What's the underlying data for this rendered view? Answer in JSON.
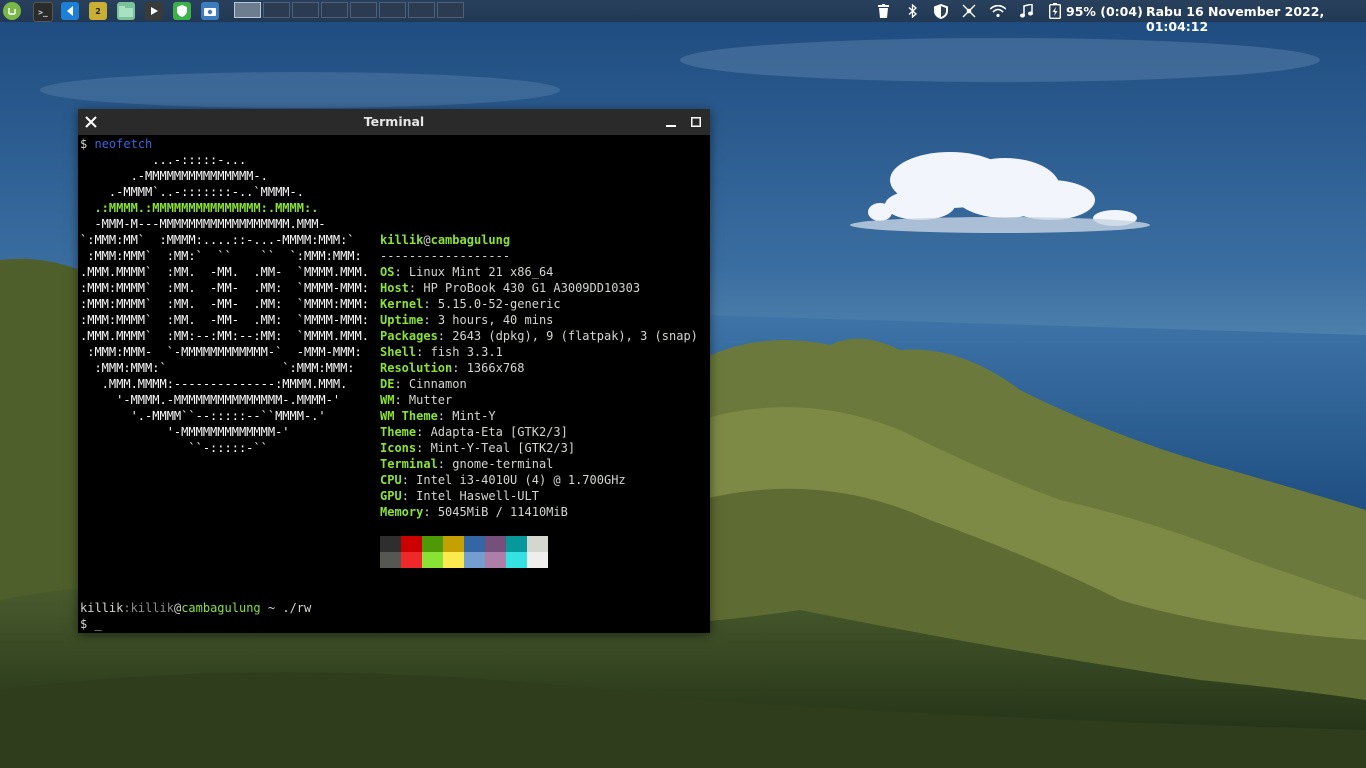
{
  "panel": {
    "launchers": [
      {
        "icon": "mint-menu-icon",
        "color": "#7ab648"
      },
      {
        "icon": "terminal-launcher-icon",
        "color": "#2b2b2b"
      },
      {
        "icon": "vscode-icon",
        "color": "#1f7fd4"
      },
      {
        "icon": "app-icon",
        "color": "#c9b034"
      },
      {
        "icon": "files-icon",
        "color": "#7bc29a"
      },
      {
        "icon": "media-player-icon",
        "color": "#3a3a3a"
      },
      {
        "icon": "shield-app-icon",
        "color": "#3cb04a"
      },
      {
        "icon": "screenshot-icon",
        "color": "#3d7bbf"
      }
    ],
    "workspaces": 8,
    "active_workspace": 1,
    "battery": "95% (0:04)",
    "clock": "Rabu 16 November 2022, 01:04:12"
  },
  "terminal": {
    "title": "Terminal",
    "prompt_symbol": "$",
    "command": "neofetch",
    "logo": [
      "          ...-:::::-...",
      "       .-MMMMMMMMMMMMMMM-.",
      "    .-MMMM`..-:::::::-..`MMMM-.",
      "  .:MMMM.:MMMMMMMMMMMMMMM:.MMMM:.",
      "  -MMM-M---MMMMMMMMMMMMMMMMMM.MMM-",
      "`:MMM:MM`  :MMMM:....::-...-MMMM:MMM:`",
      " :MMM:MMM`  :MM:`  ``    ``  `:MMM:MMM:",
      ".MMM.MMMM`  :MM.  -MM.  .MM-  `MMMM.MMM.",
      ":MMM:MMMM`  :MM.  -MM-  .MM:  `MMMM-MMM:",
      ":MMM:MMMM`  :MM.  -MM-  .MM:  `MMMM:MMM:",
      ":MMM:MMMM`  :MM.  -MM-  .MM:  `MMMM-MMM:",
      ".MMM.MMMM`  :MM:--:MM:--:MM:  `MMMM.MMM.",
      " :MMM:MMM-  `-MMMMMMMMMMMM-`  -MMM-MMM:",
      "  :MMM:MMM:`                `:MMM:MMM:",
      "   .MMM.MMMM:--------------:MMMM.MMM.",
      "     '-MMMM.-MMMMMMMMMMMMMMM-.MMMM-'",
      "       '.-MMMM``--:::::--``MMMM-.'",
      "            '-MMMMMMMMMMMMM-'",
      "               ``-:::::-``"
    ],
    "info": {
      "user": "killik",
      "host": "cambagulung",
      "separator": "------------------",
      "fields": [
        {
          "key": "OS",
          "value": "Linux Mint 21 x86_64"
        },
        {
          "key": "Host",
          "value": "HP ProBook 430 G1 A3009DD10303"
        },
        {
          "key": "Kernel",
          "value": "5.15.0-52-generic"
        },
        {
          "key": "Uptime",
          "value": "3 hours, 40 mins"
        },
        {
          "key": "Packages",
          "value": "2643 (dpkg), 9 (flatpak), 3 (snap)"
        },
        {
          "key": "Shell",
          "value": "fish 3.3.1"
        },
        {
          "key": "Resolution",
          "value": "1366x768"
        },
        {
          "key": "DE",
          "value": "Cinnamon"
        },
        {
          "key": "WM",
          "value": "Mutter"
        },
        {
          "key": "WM Theme",
          "value": "Mint-Y"
        },
        {
          "key": "Theme",
          "value": "Adapta-Eta [GTK2/3]"
        },
        {
          "key": "Icons",
          "value": "Mint-Y-Teal [GTK2/3]"
        },
        {
          "key": "Terminal",
          "value": "gnome-terminal"
        },
        {
          "key": "CPU",
          "value": "Intel i3-4010U (4) @ 1.700GHz"
        },
        {
          "key": "GPU",
          "value": "Intel Haswell-ULT"
        },
        {
          "key": "Memory",
          "value": "5045MiB / 11410MiB"
        }
      ]
    },
    "palette": {
      "normal": [
        "#2e2e2e",
        "#cc0000",
        "#4e9a06",
        "#c4a000",
        "#3465a4",
        "#75507b",
        "#06989a",
        "#d3d7cf"
      ],
      "bright": [
        "#555753",
        "#ef2929",
        "#8ae234",
        "#fce94f",
        "#729fcf",
        "#ad7fa8",
        "#34e2e2",
        "#eeeeec"
      ]
    },
    "prompt2": {
      "user": "killik",
      "sep": ":",
      "user2": "killik",
      "at": "@",
      "host": "cambagulung",
      "path": " ~ ./rw"
    },
    "cursor": "_"
  }
}
